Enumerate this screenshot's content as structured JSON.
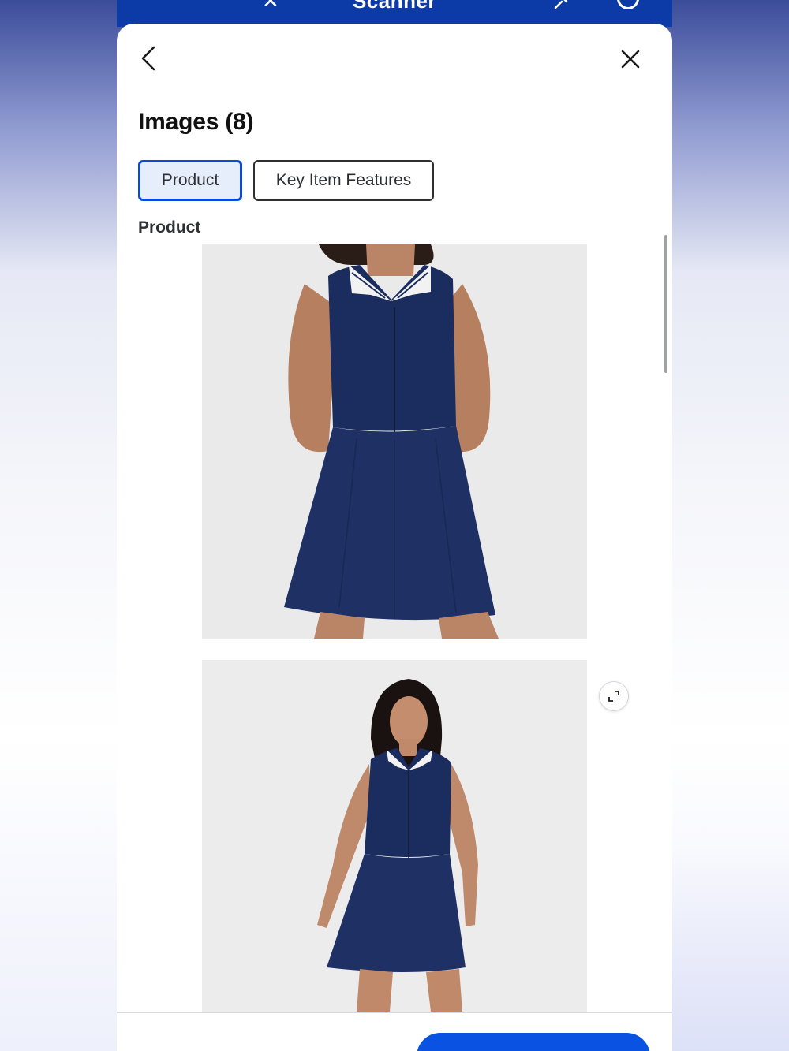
{
  "header": {
    "title": "Scanner"
  },
  "sheet": {
    "title": "Images (8)",
    "tabs": [
      {
        "label": "Product",
        "active": true
      },
      {
        "label": "Key Item Features",
        "active": false
      }
    ],
    "section_label": "Product",
    "images": [
      {
        "alt": "Navy sleeveless zip-front polo dress, close-up front view"
      },
      {
        "alt": "Navy sleeveless zip-front polo dress, full-length model view"
      }
    ]
  },
  "icons": {
    "back": "chevron-left-icon",
    "close": "close-icon",
    "expand": "expand-icon",
    "header_close": "close-icon",
    "header_pin": "pin-icon",
    "header_info": "info-icon"
  },
  "colors": {
    "header_blue": "#0c3aa6",
    "accent_blue": "#0a4ad8",
    "active_tab_bg": "#e6eefc",
    "dress_navy": "#1b2c5e",
    "cta_blue": "#0a53e2"
  }
}
